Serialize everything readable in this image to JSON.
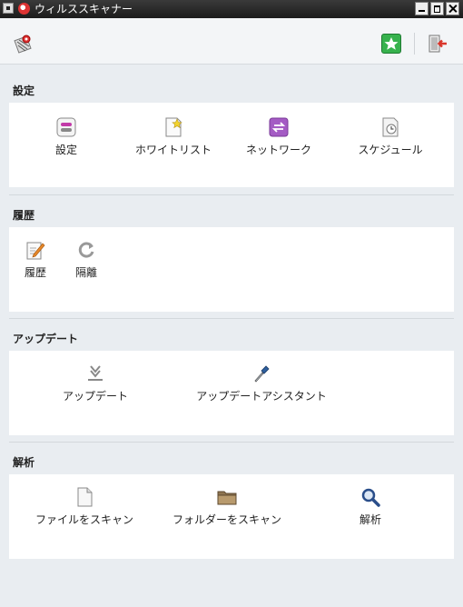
{
  "window": {
    "title": "ウィルススキャナー"
  },
  "sections": {
    "settings": {
      "title": "設定",
      "items": [
        "設定",
        "ホワイトリスト",
        "ネットワーク",
        "スケジュール"
      ]
    },
    "history": {
      "title": "履歴",
      "items": [
        "履歴",
        "隔離"
      ]
    },
    "update": {
      "title": "アップデート",
      "items": [
        "アップデート",
        "アップデートアシスタント"
      ]
    },
    "analysis": {
      "title": "解析",
      "items": [
        "ファイルをスキャン",
        "フォルダーをスキャン",
        "解析"
      ]
    }
  },
  "colors": {
    "background": "#e9edf1",
    "card": "#ffffff",
    "favorite_green": "#37b24d",
    "network_purple": "#a45bc4",
    "exit_red": "#d9362b"
  },
  "icons": {
    "toolbar_left": "virus-scanner-logo-icon",
    "toolbar_favorite": "star-icon",
    "toolbar_exit": "exit-icon"
  }
}
